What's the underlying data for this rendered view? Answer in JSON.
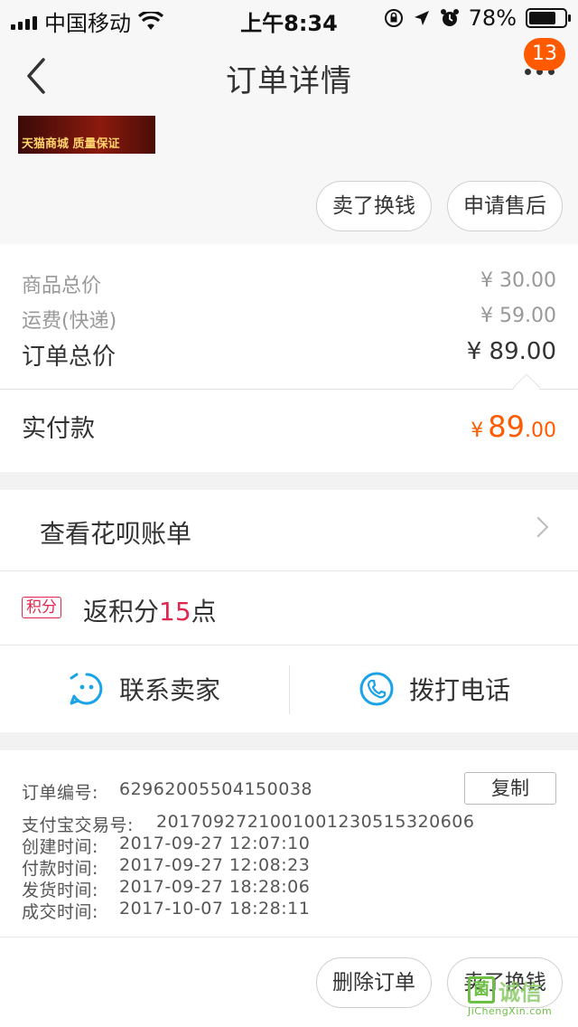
{
  "status_bar": {
    "carrier": "中国移动",
    "time": "上午8:34",
    "battery": "78%",
    "battery_level": 0.78
  },
  "nav": {
    "title": "订单详情",
    "badge_count": "13"
  },
  "product": {
    "thumb_caption": "天猫商城 质量保证",
    "buttons": [
      "卖了换钱",
      "申请售后"
    ]
  },
  "price": {
    "goods_label": "商品总价",
    "goods_value": "¥ 30.00",
    "shipping_label": "运费(快递)",
    "shipping_value": "¥ 59.00",
    "total_label": "订单总价",
    "total_value": "¥ 89.00",
    "paid_label": "实付款",
    "paid_currency": "¥",
    "paid_int": "89",
    "paid_dec": ".00"
  },
  "huabei": {
    "label": "查看花呗账单"
  },
  "points": {
    "tag": "积分",
    "prefix": "返积分",
    "number": "15",
    "suffix": "点"
  },
  "contact": {
    "seller_label": "联系卖家",
    "phone_label": "拨打电话"
  },
  "order_info": {
    "order_no_label": "订单编号:",
    "order_no": "62962005504150038",
    "copy_label": "复制",
    "alipay_label": "支付宝交易号:",
    "alipay_no": "2017092721001001230515320606",
    "created_label": "创建时间:",
    "created": "2017-09-27 12:07:10",
    "paid_label": "付款时间:",
    "paid": "2017-09-27 12:08:23",
    "shipped_label": "发货时间:",
    "shipped": "2017-09-27 18:28:06",
    "done_label": "成交时间:",
    "done": "2017-10-07 18:28:11"
  },
  "bottom_actions": [
    "删除订单",
    "卖了换钱"
  ],
  "watermark": {
    "box": "菌",
    "main": "诚信",
    "sub": "JiChengXin.com"
  },
  "colors": {
    "accent": "#ff5a00",
    "points": "#e0284f",
    "icon_blue": "#1aa3e8"
  }
}
